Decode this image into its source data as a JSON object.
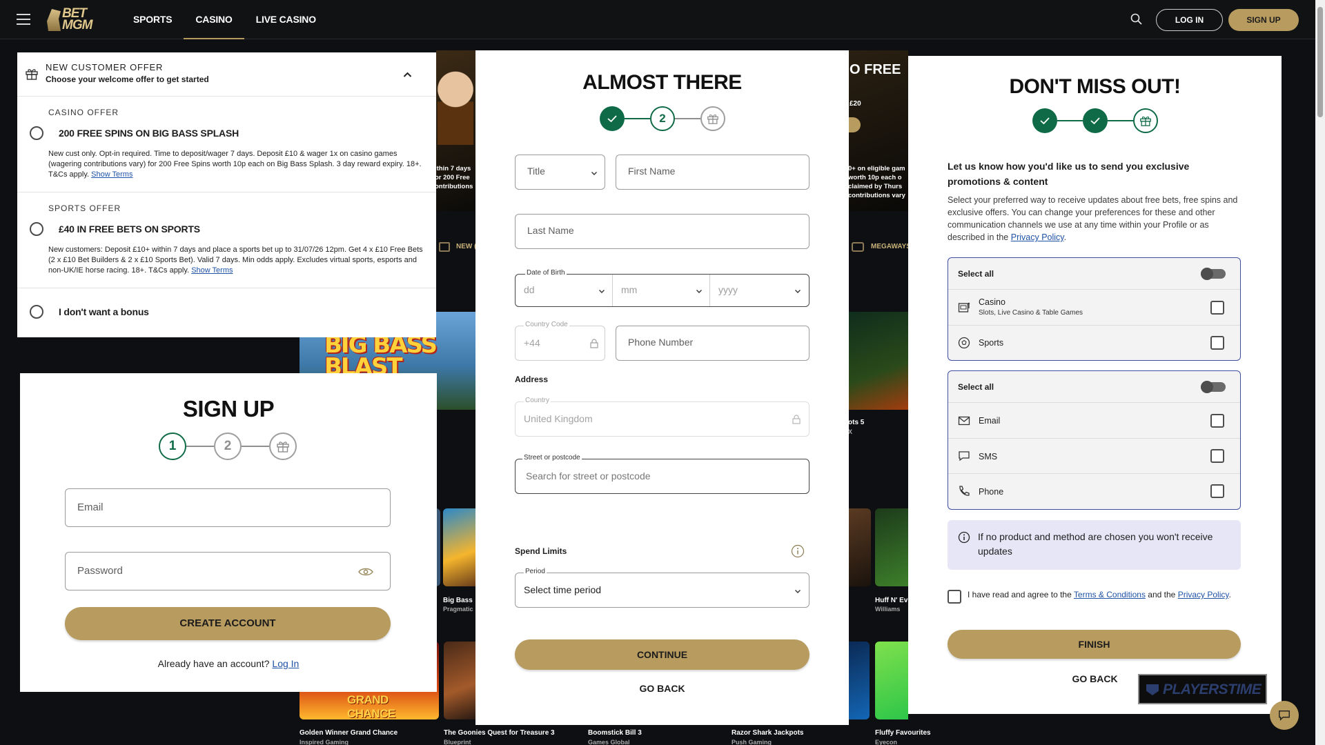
{
  "nav": {
    "logo_top": "BET",
    "logo_bottom": "MGM",
    "links": [
      "SPORTS",
      "CASINO",
      "LIVE CASINO"
    ],
    "login": "LOG IN",
    "signup": "SIGN UP"
  },
  "background": {
    "promo1": "ithin 7 days\nor 200 Free\nontributions",
    "promo2_title": "O FREE",
    "promo2_badge": "£20",
    "promo2_text": "0+ on eligible gam\nworth 10p each o\nclaimed by Thurs\ncontributions vary",
    "strip1": "NEW (",
    "strip2": "MEGAWAYS",
    "mid_tile_title": "Big Bass",
    "mid_tile_sub": "Pragmatic",
    "right_tile_title": "ots 5",
    "right_tile_sub": "X",
    "right_tile2_title": "Huff N' Ev",
    "right_tile2_sub": "Williams",
    "banner_word": "BIG BASS",
    "banner_word2": "BLAST",
    "grand_chance": "GRAND CHANCE",
    "bottom_tiles": [
      {
        "title": "Golden Winner Grand Chance",
        "sub": "Inspired Gaming"
      },
      {
        "title": "The Goonies Quest for Treasure 3",
        "sub": "Blueprint"
      },
      {
        "title": "Boomstick Bill 3",
        "sub": "Games Global"
      },
      {
        "title": "Razor Shark Jackpots",
        "sub": "Push Gaming"
      },
      {
        "title": "Fluffy Favourites",
        "sub": "Eyecon"
      }
    ]
  },
  "offer": {
    "kicker": "NEW CUSTOMER OFFER",
    "subtitle": "Choose your welcome offer to get started",
    "casino": {
      "kicker": "CASINO OFFER",
      "title": "200 FREE SPINS ON BIG BASS SPLASH",
      "desc": "New cust only. Opt-in required. Time to deposit/wager 7 days. Deposit £10 & wager 1x on casino games (wagering contributions vary) for 200 Free Spins worth 10p each on Big Bass Splash. 3 day reward expiry. 18+. T&Cs apply.",
      "link": "Show Terms"
    },
    "sports": {
      "kicker": "SPORTS OFFER",
      "title": "£40 IN FREE BETS ON SPORTS",
      "desc": "New customers: Deposit £10+ within 7 days and place a sports bet up to 31/07/26 12pm. Get 4 x £10 Free Bets (2 x £10 Bet Builders & 2 x £10 Sports Bet). Valid 7 days. Min odds apply. Excludes virtual sports, esports and non-UK/IE horse racing. 18+. T&Cs apply.",
      "link": "Show Terms"
    },
    "none": "I don't want a bonus"
  },
  "signup": {
    "title": "SIGN UP",
    "step1": "1",
    "step2": "2",
    "email_placeholder": "Email",
    "password_placeholder": "Password",
    "create": "CREATE ACCOUNT",
    "have_account": "Already have an account?",
    "login_link": "Log In"
  },
  "almost": {
    "title": "ALMOST THERE",
    "step2": "2",
    "title_field": "Title",
    "first_name": "First Name",
    "last_name": "Last Name",
    "dob_label": "Date of Birth",
    "dd": "dd",
    "mm": "mm",
    "yyyy": "yyyy",
    "country_code_label": "Country Code",
    "country_code": "+44",
    "phone": "Phone Number",
    "address_label": "Address",
    "country_label": "Country",
    "country": "United Kingdom",
    "street_label": "Street or postcode",
    "street_placeholder": "Search for street or postcode",
    "spend_limits": "Spend Limits",
    "period_label": "Period",
    "period_value": "Select time period",
    "continue": "CONTINUE",
    "go_back": "GO BACK"
  },
  "dontmiss": {
    "title": "DON'T MISS OUT!",
    "intro_bold": "Let us know how you'd like us to send you exclusive promotions & content",
    "intro": "Select your preferred way to receive updates about free bets, free spins and exclusive offers. You can change your preferences for these and other communication channels we use at any time within your Profile or as described in the",
    "intro_link": "Privacy Policy",
    "select_all_1": "Select all",
    "casino": "Casino",
    "casino_sub": "Slots, Live Casino & Table Games",
    "sports": "Sports",
    "select_all_2": "Select all",
    "email": "Email",
    "sms": "SMS",
    "phone": "Phone",
    "info": "If no product and method are chosen you won't receive updates",
    "terms_pre": "I have read and agree to the",
    "terms_link": "Terms & Conditions",
    "terms_mid": "and the",
    "privacy_link": "Privacy Policy",
    "finish": "FINISH",
    "go_back": "GO BACK"
  },
  "watermark": "PLAYERSTIME",
  "colors": {
    "gold": "#b89b5e",
    "green": "#0f6b47",
    "link": "#1d52a6",
    "nav_bg": "#111214"
  }
}
